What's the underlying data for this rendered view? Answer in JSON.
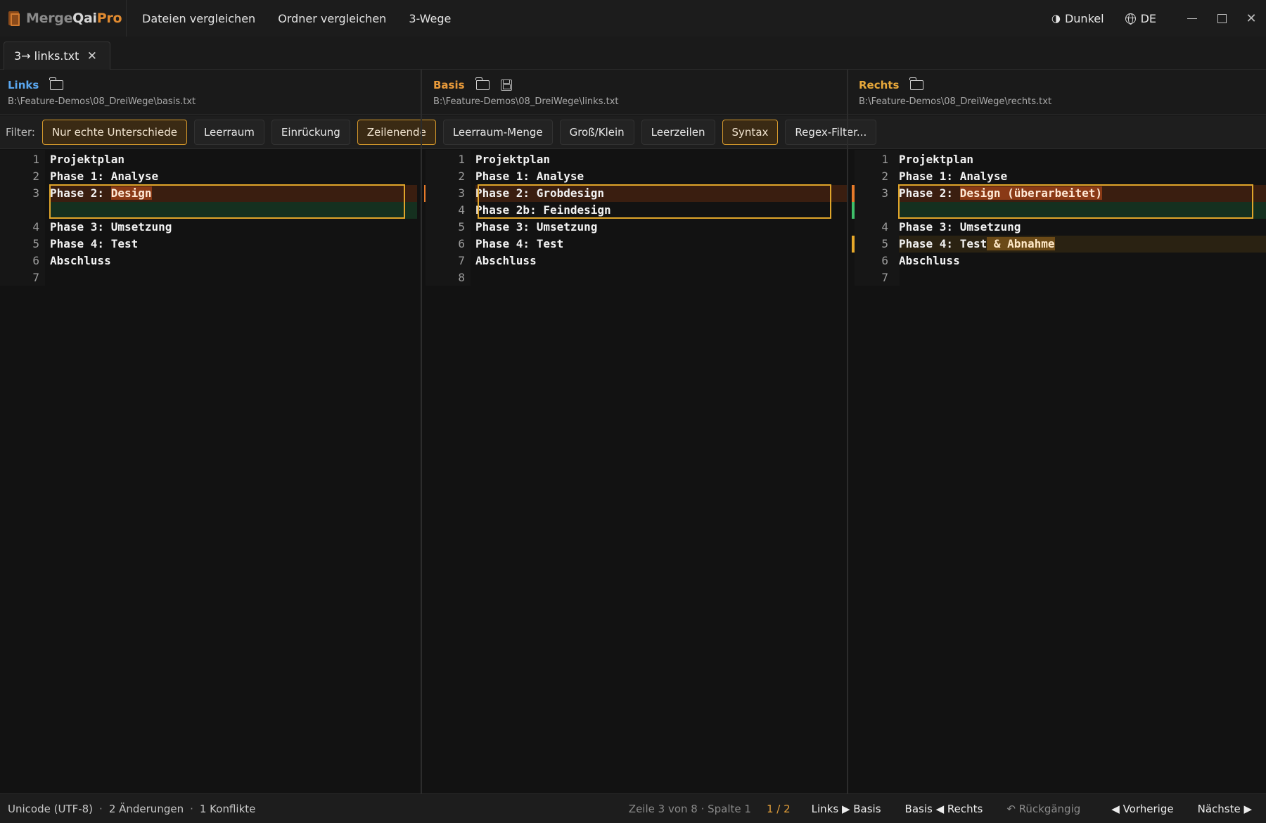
{
  "app": {
    "name_part1": "Merge",
    "name_part2": "Qai",
    "name_part3": "Pro",
    "colors": {
      "accent": "#e08a30",
      "link_left": "#5aa7f0",
      "link_mid": "#e89a3a",
      "link_right": "#e8a83a"
    }
  },
  "menu": {
    "items": [
      "Dateien vergleichen",
      "Ordner vergleichen",
      "3-Wege"
    ]
  },
  "titlebar": {
    "theme_label": "Dunkel",
    "lang_label": "DE",
    "theme_icon": "half-circle-icon",
    "lang_icon": "globe-icon"
  },
  "tab": {
    "label": "3→ links.txt",
    "close": "✕"
  },
  "panes": {
    "left": {
      "title": "Links",
      "path": "B:\\Feature-Demos\\08_DreiWege\\basis.txt"
    },
    "mid": {
      "title": "Basis",
      "path": "B:\\Feature-Demos\\08_DreiWege\\links.txt"
    },
    "right": {
      "title": "Rechts",
      "path": "B:\\Feature-Demos\\08_DreiWege\\rechts.txt"
    }
  },
  "filter": {
    "label": "Filter:",
    "chips": [
      {
        "label": "Nur echte Unterschiede",
        "active": true
      },
      {
        "label": "Leerraum",
        "active": false
      },
      {
        "label": "Einrückung",
        "active": false
      },
      {
        "label": "Zeilenende",
        "active": true
      },
      {
        "label": "Leerraum-Menge",
        "active": false
      },
      {
        "label": "Groß/Klein",
        "active": false
      },
      {
        "label": "Leerzeilen",
        "active": false
      },
      {
        "label": "Syntax",
        "active": true
      },
      {
        "label": "Regex-Filter...",
        "active": false
      }
    ]
  },
  "editor": {
    "left": {
      "l1": {
        "no": "1",
        "text": "Projektplan"
      },
      "l2": {
        "no": "2",
        "text": "Phase 1: Analyse"
      },
      "l3": {
        "no": "3",
        "text": "Phase 2: ",
        "hl": "Design"
      },
      "l4": {
        "no": "4",
        "text": "Phase 3: Umsetzung"
      },
      "l5": {
        "no": "5",
        "text": "Phase 4: Test"
      },
      "l6": {
        "no": "6",
        "text": "Abschluss"
      },
      "l7": {
        "no": "7",
        "text": ""
      }
    },
    "mid": {
      "l1": {
        "no": "1",
        "text": "Projektplan"
      },
      "l2": {
        "no": "2",
        "text": "Phase 1: Analyse"
      },
      "l3": {
        "no": "3",
        "text": "Phase 2: Grobdesign"
      },
      "l4": {
        "no": "4",
        "text": "Phase 2b: Feindesign"
      },
      "l5": {
        "no": "5",
        "text": "Phase 3: Umsetzung"
      },
      "l6": {
        "no": "6",
        "text": "Phase 4: Test"
      },
      "l7": {
        "no": "7",
        "text": "Abschluss"
      },
      "l8": {
        "no": "8",
        "text": ""
      }
    },
    "right": {
      "l1": {
        "no": "1",
        "text": "Projektplan"
      },
      "l2": {
        "no": "2",
        "text": "Phase 1: Analyse"
      },
      "l3": {
        "no": "3",
        "text": "Phase 2: ",
        "hl": "Design (überarbeitet)"
      },
      "l4": {
        "no": "4",
        "text": "Phase 3: Umsetzung"
      },
      "l5": {
        "no": "5",
        "text": "Phase 4: Test",
        "hl": " & Abnahme"
      },
      "l6": {
        "no": "6",
        "text": "Abschluss"
      },
      "l7": {
        "no": "7",
        "text": ""
      }
    }
  },
  "status": {
    "encoding": "Unicode (UTF-8)",
    "changes": "2 Änderungen",
    "conflicts": "1 Konflikte",
    "position": "Zeile 3 von 8 · Spalte 1",
    "counter": "1 / 2",
    "btn_lr": "Links ▶ Basis",
    "btn_rl": "Basis ◀ Rechts",
    "undo": "↶ Rückgängig",
    "prev": "◀ Vorherige",
    "next": "Nächste ▶"
  }
}
